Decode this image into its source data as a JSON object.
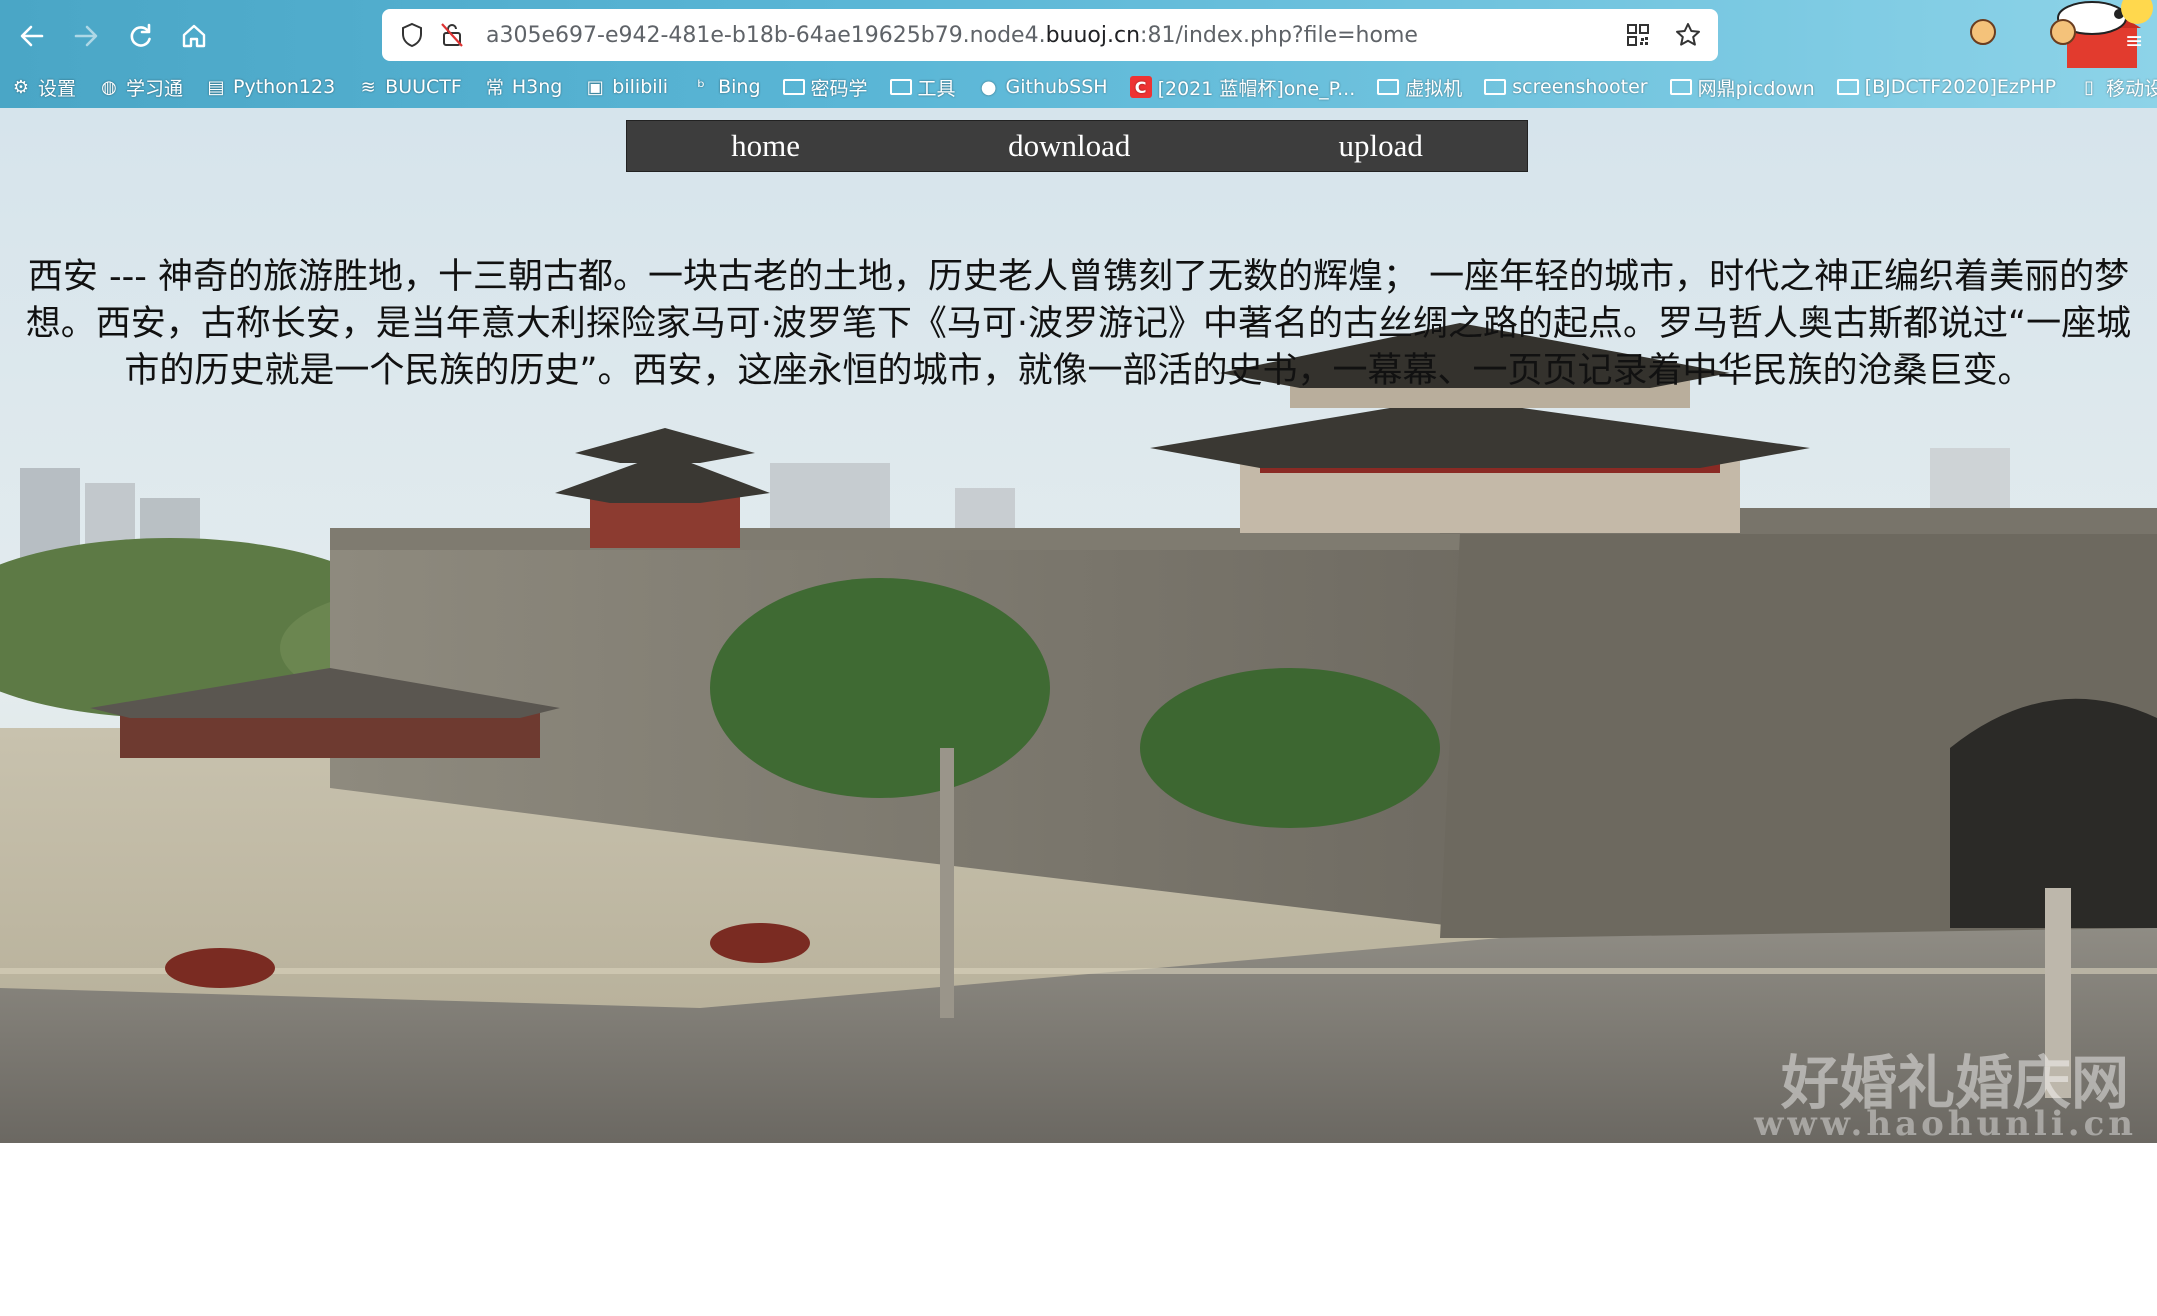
{
  "browser": {
    "url_prefix": "a305e697-e942-481e-b18b-64ae19625b79.node4.",
    "url_host": "buuoj.cn",
    "url_suffix": ":81/index.php?file=home",
    "bookmarks": [
      {
        "label": "设置",
        "icon": "gear-icon"
      },
      {
        "label": "学习通",
        "icon": "globe-icon"
      },
      {
        "label": "Python123",
        "icon": "python-icon"
      },
      {
        "label": "BUUCTF",
        "icon": "buuctf-icon"
      },
      {
        "label": "H3ng",
        "icon": "h3ng-icon"
      },
      {
        "label": "bilibili",
        "icon": "bilibili-icon"
      },
      {
        "label": "Bing",
        "icon": "bing-icon"
      },
      {
        "label": "密码学",
        "icon": "folder-icon"
      },
      {
        "label": "工具",
        "icon": "folder-icon"
      },
      {
        "label": "GithubSSH",
        "icon": "github-icon"
      },
      {
        "label": "[2021 蓝帽杯]one_P...",
        "icon": "csdn-icon"
      },
      {
        "label": "虚拟机",
        "icon": "folder-icon"
      },
      {
        "label": "screenshooter",
        "icon": "folder-icon"
      },
      {
        "label": "网鼎picdown",
        "icon": "folder-icon"
      },
      {
        "label": "[BJDCTF2020]EzPHP",
        "icon": "folder-icon"
      },
      {
        "label": "移动设备上的书签",
        "icon": "mobile-icon"
      }
    ]
  },
  "nav": {
    "home": "home",
    "download": "download",
    "upload": "upload"
  },
  "content": {
    "intro": "西安 --- 神奇的旅游胜地，十三朝古都。一块古老的土地，历史老人曾镌刻了无数的辉煌； 一座年轻的城市，时代之神正编织着美丽的梦想。西安，古称长安，是当年意大利探险家马可·波罗笔下《马可·波罗游记》中著名的古丝绸之路的起点。罗马哲人奥古斯都说过“一座城市的历史就是一个民族的历史”。西安，这座永恒的城市，就像一部活的史书，一幕幕、一页页记录着中华民族的沧桑巨变。"
  },
  "watermark": {
    "brand": "好婚礼婚庆网",
    "url": "www.haohunli.cn"
  }
}
